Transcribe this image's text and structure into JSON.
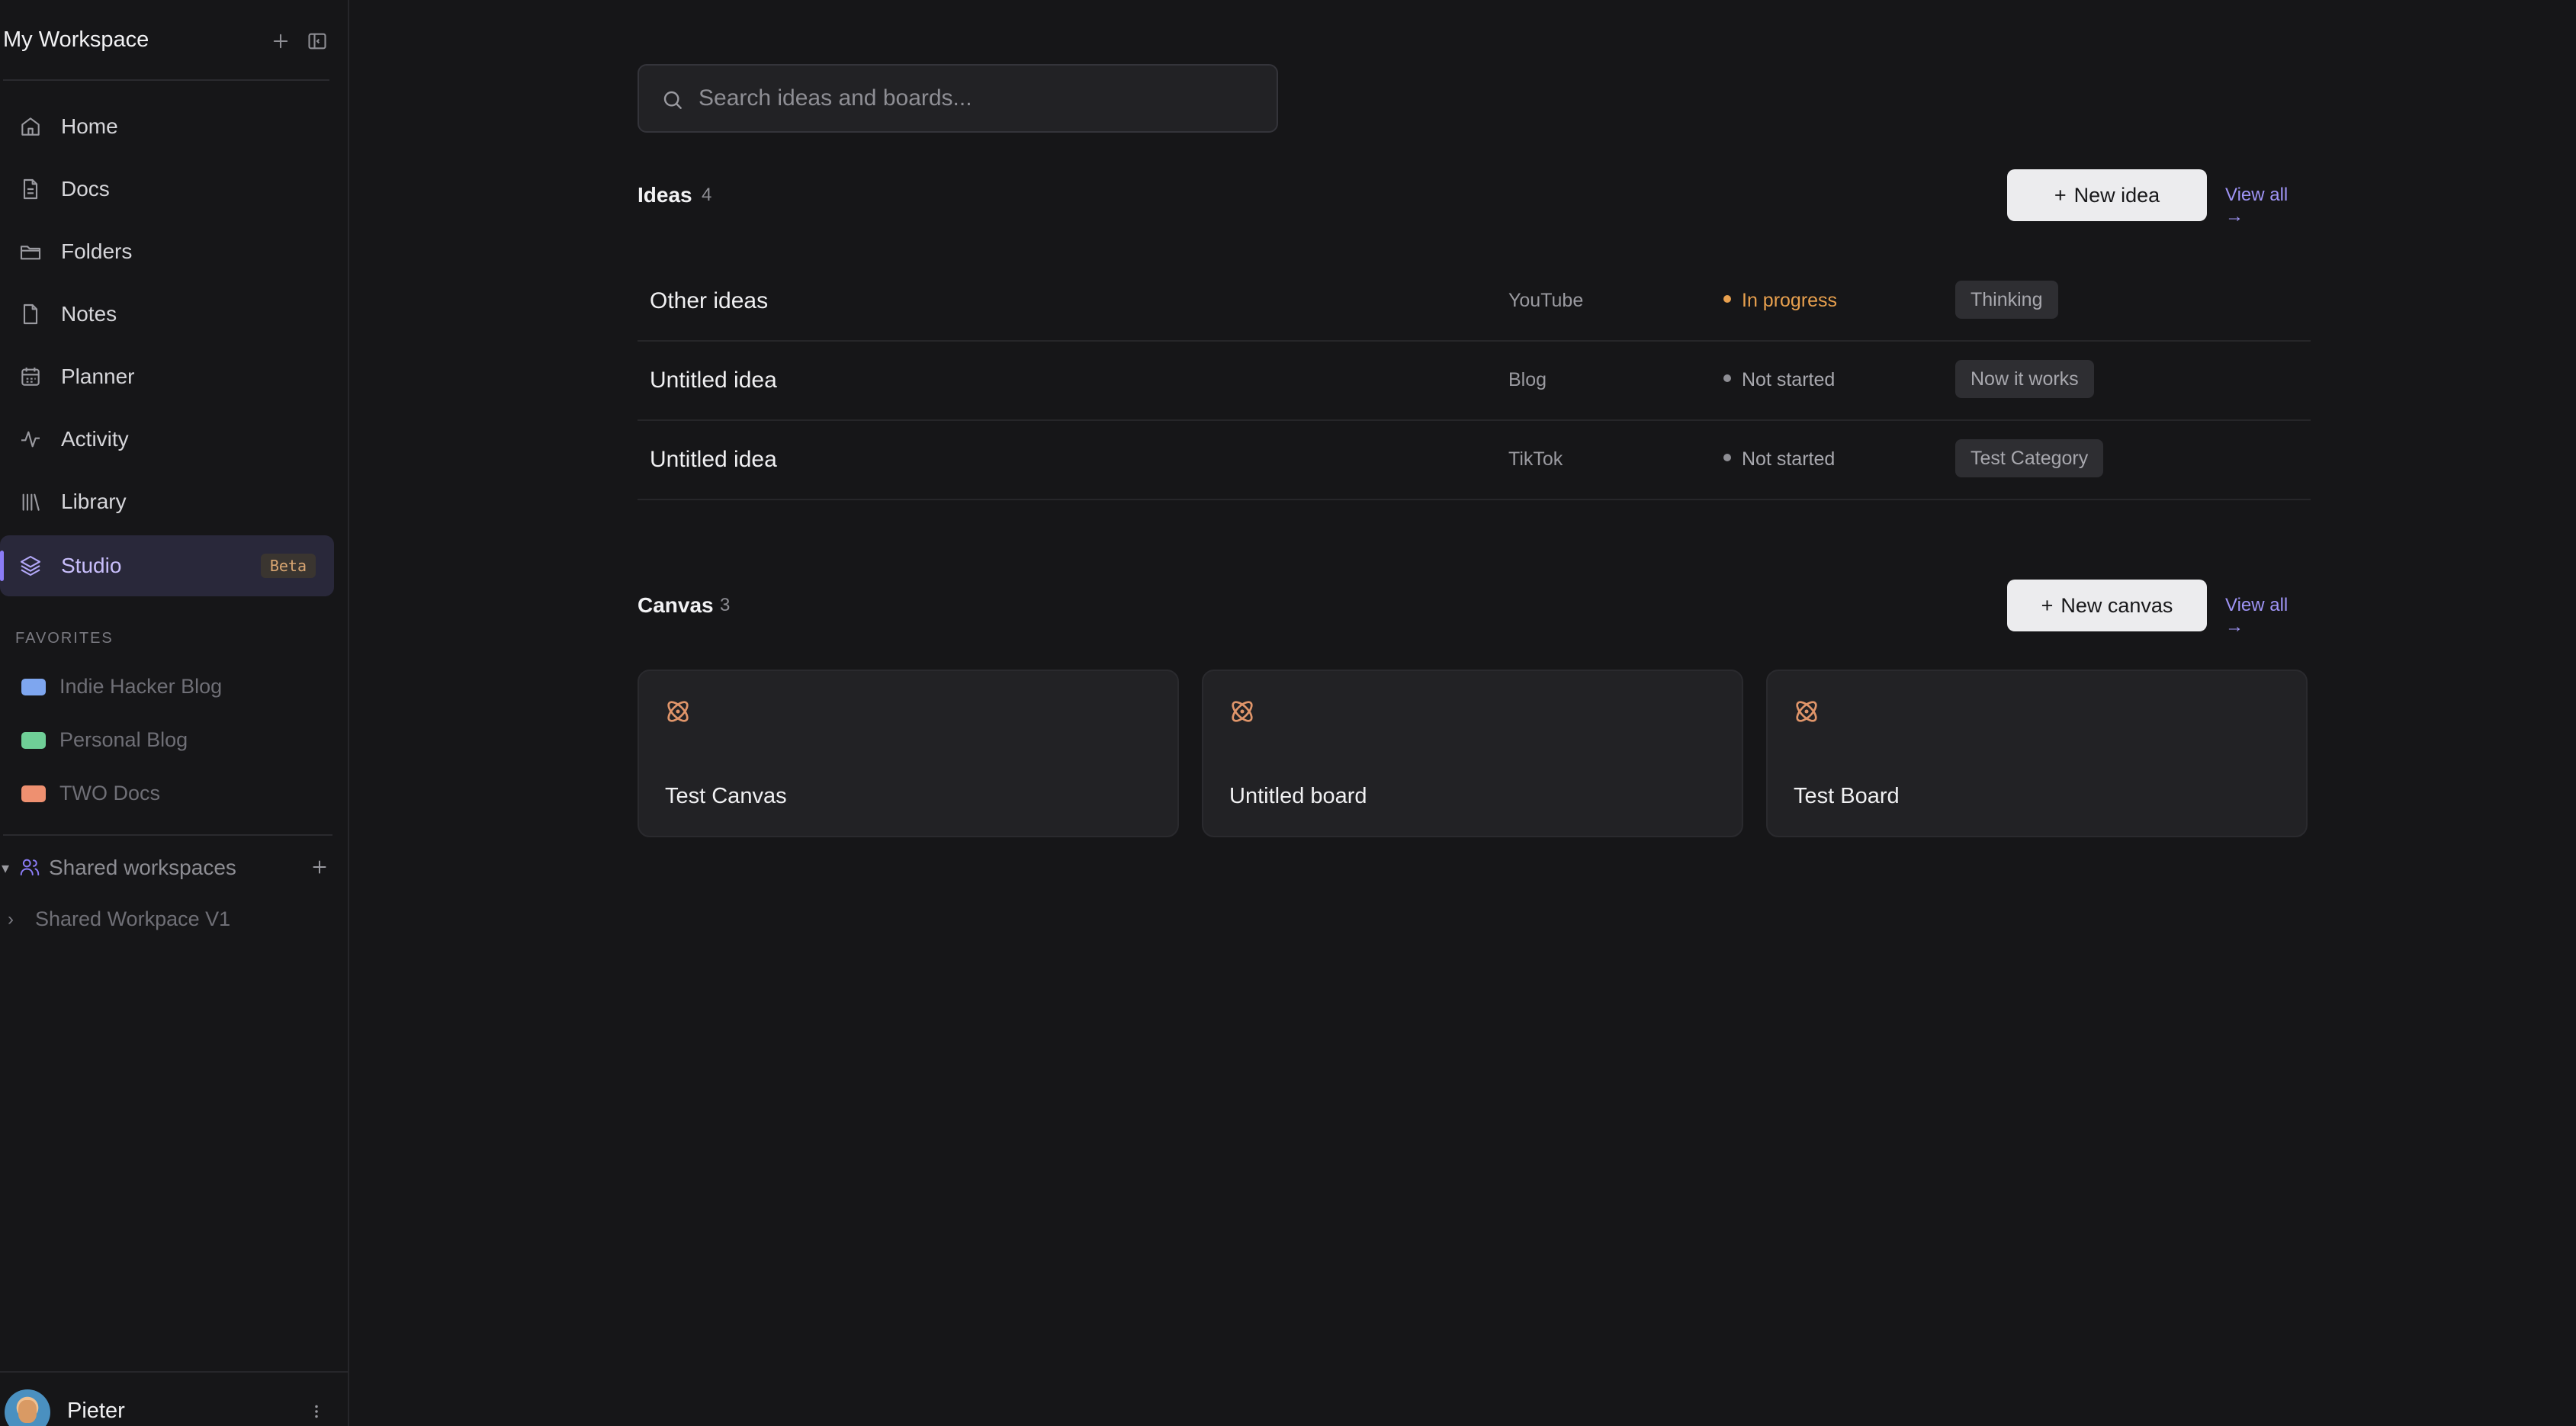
{
  "workspace": {
    "title": "My Workspace"
  },
  "nav": {
    "items": [
      {
        "label": "Home",
        "icon": "home-icon"
      },
      {
        "label": "Docs",
        "icon": "document-icon"
      },
      {
        "label": "Folders",
        "icon": "folder-icon"
      },
      {
        "label": "Notes",
        "icon": "note-icon"
      },
      {
        "label": "Planner",
        "icon": "calendar-icon"
      },
      {
        "label": "Activity",
        "icon": "activity-icon"
      },
      {
        "label": "Library",
        "icon": "library-icon"
      },
      {
        "label": "Studio",
        "icon": "layers-icon",
        "badge": "Beta",
        "active": true
      }
    ]
  },
  "favorites": {
    "title": "FAVORITES",
    "items": [
      {
        "label": "Indie Hacker Blog",
        "color": "#7ea6ef"
      },
      {
        "label": "Personal Blog",
        "color": "#6fcf97"
      },
      {
        "label": "TWO Docs",
        "color": "#ee9070"
      }
    ]
  },
  "shared": {
    "title": "Shared workspaces",
    "items": [
      {
        "label": "Shared Workpace V1"
      }
    ]
  },
  "user": {
    "name": "Pieter"
  },
  "search": {
    "placeholder": "Search ideas and boards..."
  },
  "ideas": {
    "title": "Ideas",
    "count": "4",
    "new_label": "New idea",
    "view_all": "View all →",
    "rows": [
      {
        "name": "Other ideas",
        "channel": "YouTube",
        "status": "In progress",
        "tag": "Thinking"
      },
      {
        "name": "Untitled idea",
        "channel": "Blog",
        "status": "Not started",
        "tag": "Now it works"
      },
      {
        "name": "Untitled idea",
        "channel": "TikTok",
        "status": "Not started",
        "tag": "Test Category"
      }
    ]
  },
  "canvas": {
    "title": "Canvas",
    "count": "3",
    "new_label": "New canvas",
    "view_all": "View all →",
    "cards": [
      {
        "name": "Test Canvas"
      },
      {
        "name": "Untitled board"
      },
      {
        "name": "Test Board"
      }
    ]
  },
  "colors": {
    "accent": "#8b7cf6",
    "in_progress": "#e8a04e",
    "canvas_icon": "#e0956a"
  }
}
